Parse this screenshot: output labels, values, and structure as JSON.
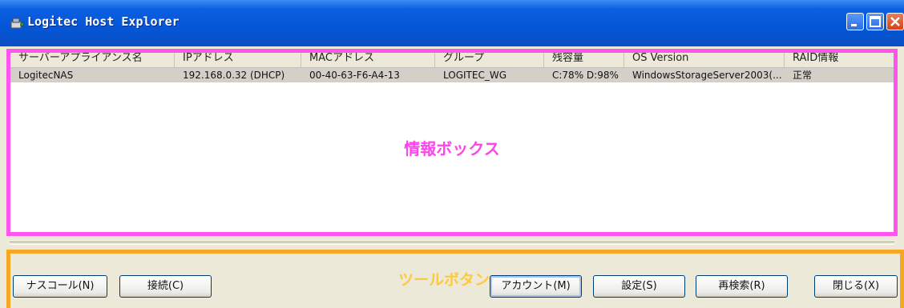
{
  "window": {
    "title": "Logitec Host Explorer"
  },
  "colors": {
    "title_bar": "#0556d6",
    "info_highlight": "#ff55ee",
    "tool_highlight": "#f5a623"
  },
  "list": {
    "columns": [
      "サーバーアプライアンス名",
      "IPアドレス",
      "MACアドレス",
      "グループ",
      "残容量",
      "OS Version",
      "RAID情報"
    ],
    "rows": [
      [
        "LogitecNAS",
        "192.168.0.32 (DHCP)",
        "00-40-63-F6-A4-13",
        "LOGITEC_WG",
        "C:78% D:98%",
        "WindowsStorageServer2003(...",
        "正常"
      ]
    ]
  },
  "annotations": {
    "info_box": "情報ボックス",
    "tool_buttons": "ツールボタン"
  },
  "buttons": {
    "nas_call": "ナスコール(N)",
    "connect": "接続(C)",
    "account": "アカウント(M)",
    "settings": "設定(S)",
    "research": "再検索(R)",
    "close": "閉じる(X)"
  }
}
